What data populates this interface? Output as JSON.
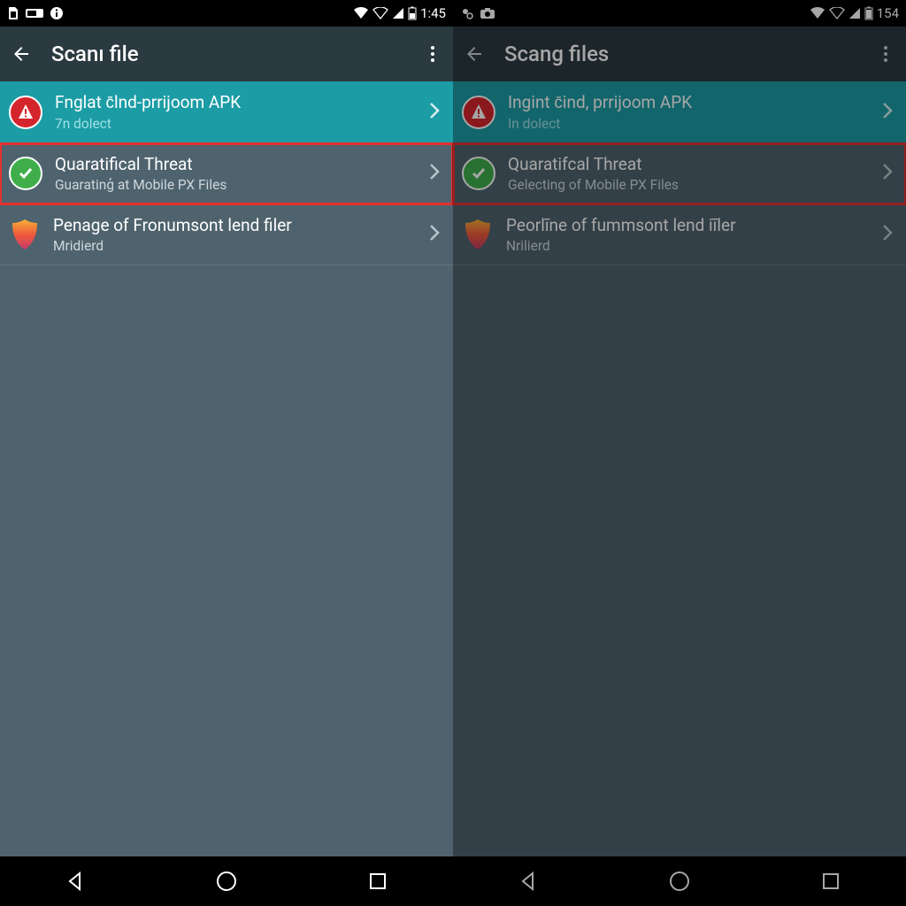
{
  "left": {
    "statusbar": {
      "time": "1:45"
    },
    "appbar": {
      "title": "Scanı file"
    },
    "rows": [
      {
        "title": "Fnglat c̄lnd-prrijoom APK",
        "sub": "7n dolect"
      },
      {
        "title": "Quaratifical Threat",
        "sub": "Guaratinģ at Mobile PX Files"
      },
      {
        "title": "Penage of Fronumsont lend filer",
        "sub": "Mridierd"
      }
    ]
  },
  "right": {
    "statusbar": {
      "time": "154"
    },
    "appbar": {
      "title": "Scang files"
    },
    "rows": [
      {
        "title": "Ingint c̄ind, prrijoom APK",
        "sub": "In dolect"
      },
      {
        "title": "Quaratifcal Threat",
        "sub": "Gelecting of Mobile PX Files"
      },
      {
        "title": "Peorlīne of fummsont lend iīler",
        "sub": "Nrilierd"
      }
    ]
  }
}
